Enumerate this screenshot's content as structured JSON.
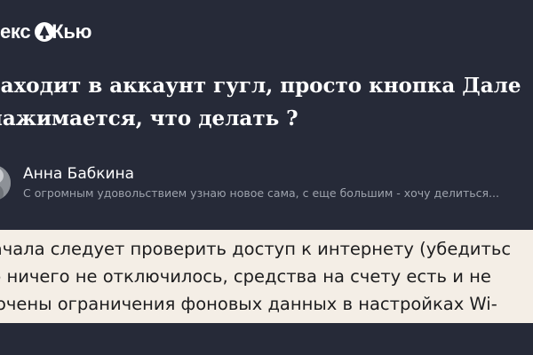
{
  "header": {
    "logo_text_left": "екс",
    "logo_text_right": "Кью"
  },
  "question": {
    "title_line1": "заходит в аккаунт гугл, просто кнопка Дале",
    "title_line2": "нажимается, что делать ?"
  },
  "author": {
    "name": "Анна Бабкина",
    "bio": "С огромным удовольствием узнаю новое сама, с еще большим - хочу делиться..."
  },
  "answer": {
    "line1": "начала следует проверить доступ к интернету (убедитьс",
    "line2": "то ничего не отключилось, средства на счету есть и не",
    "line3": "лючены ограничения фоновых данных в настройках Wi-"
  },
  "colors": {
    "background": "#262a38",
    "card": "#f4eee6",
    "muted_text": "#9ea3ad"
  }
}
